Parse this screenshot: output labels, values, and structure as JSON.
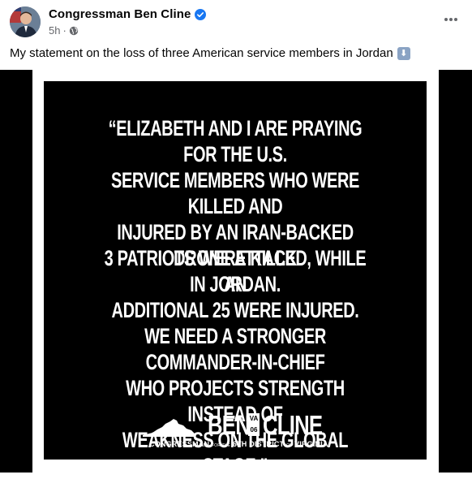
{
  "post": {
    "author": "Congressman Ben Cline",
    "timestamp": "5h",
    "dot": "·",
    "caption": "My statement on the loss of three American service members in Jordan",
    "caption_emoji": "⬇"
  },
  "graphic": {
    "statement_1": "“ELIZABETH AND I ARE PRAYING FOR THE U.S.\nSERVICE MEMBERS WHO WERE KILLED AND\nINJURED BY AN IRAN-BACKED DRONE ATTACK\nIN JORDAN.",
    "statement_2": "3 PATRIOTS WERE KILLED, WHILE AN\nADDITIONAL 25 WERE INJURED.",
    "statement_3": "WE NEED A STRONGER COMMANDER-IN-CHIEF\nWHO PROJECTS STRENGTH INSTEAD OF\nWEAKNESS ON THE GLOBAL STAGE.”",
    "logo": {
      "first": "BEN",
      "badge_top": "VA",
      "badge_bottom": "06",
      "last": "CLINE",
      "tagline_a": "CONGRESSMAN",
      "tagline_b": "FOR THE",
      "tagline_c": "6TH DISTRICT",
      "tagline_d": "OF",
      "tagline_e": "VIRGINIA"
    }
  },
  "colors": {
    "verified": "#1877f2",
    "meta_text": "#65676b",
    "graphic_bg": "#000000",
    "graphic_text": "#ffffff"
  }
}
